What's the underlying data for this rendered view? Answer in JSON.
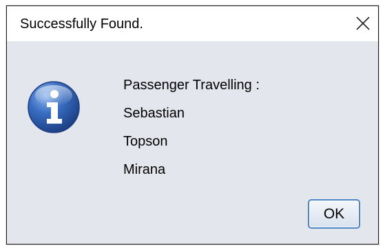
{
  "dialog": {
    "title": "Successfully Found.",
    "close_icon": "close-icon",
    "icon": "information-icon",
    "message_lines": [
      "Passenger Travelling :",
      "Sebastian",
      "Topson",
      "Mirana"
    ],
    "ok_label": "OK"
  },
  "colors": {
    "dialog_background": "#e3e6ec",
    "titlebar_background": "#ffffff",
    "icon_blue": "#2f5fb0",
    "button_border": "#4d86c4"
  }
}
